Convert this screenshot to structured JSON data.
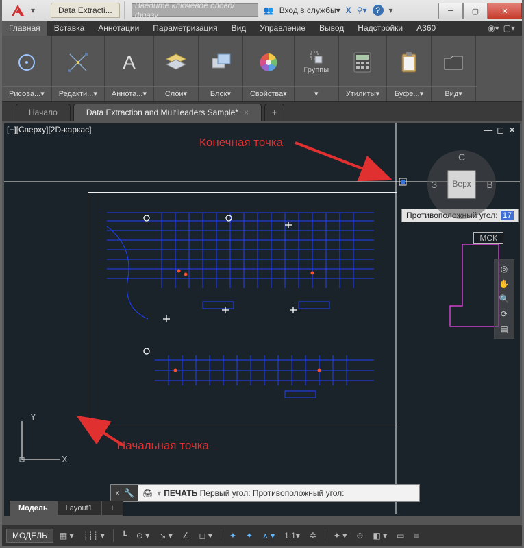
{
  "title": {
    "doc_tab": "Data Extracti...",
    "search_placeholder": "Введите ключевое слово/фразу",
    "login": "Вход в службы"
  },
  "menu": {
    "items": [
      "Главная",
      "Вставка",
      "Аннотации",
      "Параметризация",
      "Вид",
      "Управление",
      "Вывод",
      "Надстройки",
      "A360"
    ],
    "active": 0
  },
  "ribbon": {
    "panels": [
      {
        "label": "Рисова...",
        "icon": "circle"
      },
      {
        "label": "Редакти...",
        "icon": "move"
      },
      {
        "label": "Аннота...",
        "icon": "letter-a"
      },
      {
        "label": "Слои",
        "icon": "layers"
      },
      {
        "label": "Блок",
        "icon": "block"
      },
      {
        "label": "Свойства",
        "icon": "colorwheel"
      },
      {
        "label": "Группы",
        "icon": "group",
        "compact": true
      },
      {
        "label": "Утилиты",
        "icon": "calc"
      },
      {
        "label": "Буфе...",
        "icon": "clipboard"
      },
      {
        "label": "Вид",
        "icon": "folder"
      }
    ]
  },
  "file_tabs": {
    "start": "Начало",
    "doc": "Data Extraction and Multileaders Sample*"
  },
  "viewport": {
    "label": "[−][Сверху][2D-каркас]"
  },
  "annotations": {
    "end_point": "Конечная точка",
    "start_point": "Начальная точка"
  },
  "tooltip": {
    "label": "Противоположный угол:",
    "value": "17"
  },
  "mck_label": "МСК",
  "viewcube": {
    "n": "С",
    "e": "В",
    "w": "З",
    "face": "Верх"
  },
  "ucs": {
    "x": "X",
    "y": "Y"
  },
  "cmd": {
    "command": "ПЕЧАТЬ",
    "rest": "Первый угол: Противоположный угол:"
  },
  "layout_tabs": {
    "model": "Модель",
    "layout1": "Layout1"
  },
  "status": {
    "model": "МОДЕЛЬ",
    "scale": "1:1"
  }
}
